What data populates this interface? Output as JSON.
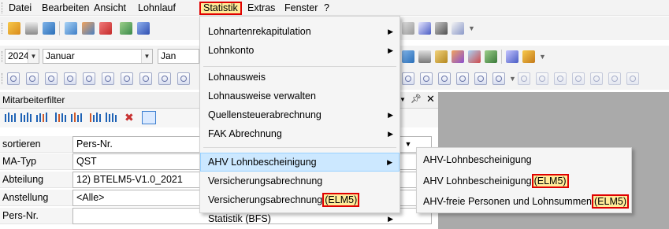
{
  "menubar": {
    "items": [
      "Datei",
      "Bearbeiten",
      "Ansicht",
      "Lohnlauf",
      "Statistik",
      "Extras",
      "Fenster",
      "?"
    ],
    "active_index": 4
  },
  "period": {
    "year": "2024",
    "month": "Januar",
    "month_short": "Jan"
  },
  "filter_panel": {
    "title": "Mitarbeiterfilter",
    "pin_icon": "pin",
    "rows": [
      {
        "label": "sortieren",
        "value": "Pers-Nr."
      },
      {
        "label": "MA-Typ",
        "value": "QST"
      },
      {
        "label": "Abteilung",
        "value": "12) BTELM5-V1.0_2021"
      },
      {
        "label": "Anstellung",
        "value": "<Alle>"
      },
      {
        "label": "Pers-Nr.",
        "value": ""
      }
    ]
  },
  "statistik_menu": {
    "items": [
      {
        "label": "Lohnartenrekapitulation",
        "submenu": true
      },
      {
        "label": "Lohnkonto",
        "submenu": true
      },
      {
        "label": "Lohnausweis",
        "submenu": false
      },
      {
        "label": "Lohnausweise verwalten",
        "submenu": false
      },
      {
        "label": "Quellensteuerabrechnung",
        "submenu": true
      },
      {
        "label": "FAK Abrechnung",
        "submenu": true
      },
      {
        "label": "AHV Lohnbescheinigung",
        "submenu": true
      },
      {
        "label": "Versicherungsabrechnung",
        "submenu": false
      },
      {
        "label": "Versicherungsabrechnung",
        "tag": "(ELM5)",
        "submenu": false
      },
      {
        "label": "Statistik (BFS)",
        "submenu": true
      }
    ],
    "highlighted_index": 6
  },
  "ahv_submenu": {
    "items": [
      {
        "label": "AHV-Lohnbescheinigung",
        "tag": ""
      },
      {
        "label": "AHV Lohnbescheinigung",
        "tag": "(ELM5)"
      },
      {
        "label": "AHV-freie Personen und Lohnsummen",
        "tag": "(ELM5)"
      }
    ]
  },
  "colors": {
    "highlight_border": "#e00000",
    "highlight_fill": "#ffeb9a",
    "menu_hover": "#cce8ff",
    "workspace": "#aaaaaa"
  }
}
